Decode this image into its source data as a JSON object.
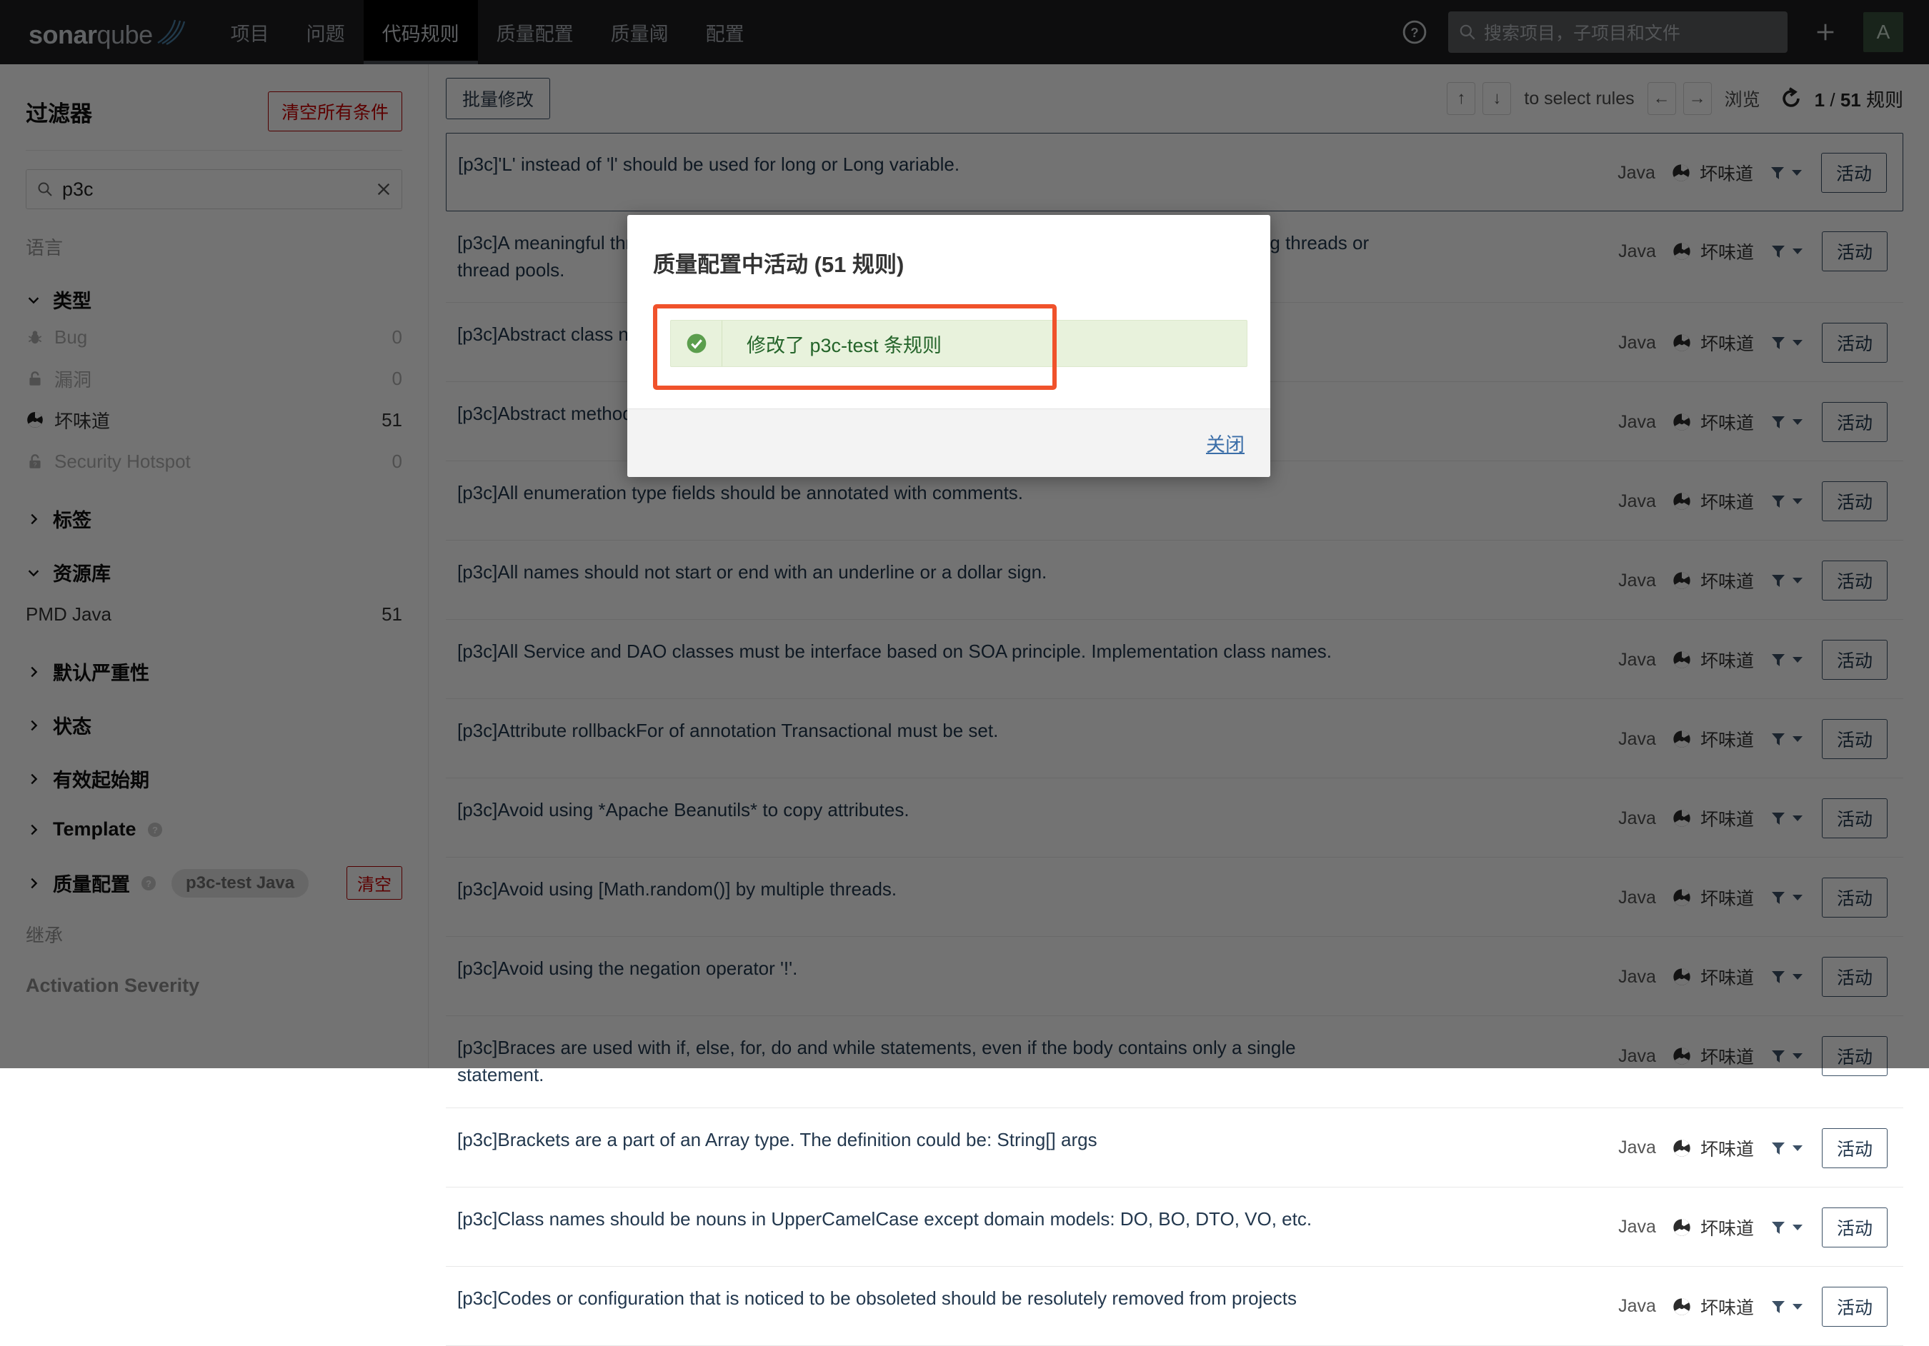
{
  "topnav": {
    "logo": {
      "bold": "sonar",
      "light": "qube",
      "icon": "sonarqube-logo-icon"
    },
    "items": [
      {
        "label": "项目",
        "active": false
      },
      {
        "label": "问题",
        "active": false
      },
      {
        "label": "代码规则",
        "active": true
      },
      {
        "label": "质量配置",
        "active": false
      },
      {
        "label": "质量阈",
        "active": false
      },
      {
        "label": "配置",
        "active": false
      }
    ],
    "help_icon": "help-circle-icon",
    "search": {
      "placeholder": "搜索项目，子项目和文件",
      "value": "",
      "icon": "search-icon"
    },
    "plus_icon": "plus-icon",
    "avatar_initial": "A",
    "avatar_color": "#39503d"
  },
  "sidebar": {
    "title": "过滤器",
    "clear_all_label": "清空所有条件",
    "search": {
      "value": "p3c",
      "placeholder": "",
      "icon": "search-icon",
      "clear_icon": "close-x-icon"
    },
    "language_label": "语言",
    "type_facet": {
      "label": "类型",
      "expanded": true,
      "rows": [
        {
          "icon": "bug-icon",
          "label": "Bug",
          "count": "0",
          "dim": true
        },
        {
          "icon": "vulnerability-icon",
          "label": "漏洞",
          "count": "0",
          "dim": true
        },
        {
          "icon": "code-smell-icon",
          "label": "坏味道",
          "count": "51",
          "dim": false
        },
        {
          "icon": "security-hotspot-icon",
          "label": "Security Hotspot",
          "count": "0",
          "dim": true
        }
      ]
    },
    "tags_facet": {
      "label": "标签",
      "expanded": false
    },
    "repo_facet": {
      "label": "资源库",
      "expanded": true,
      "rows": [
        {
          "label": "PMD Java",
          "count": "51"
        }
      ]
    },
    "severity_facet": {
      "label": "默认严重性",
      "expanded": false
    },
    "status_facet": {
      "label": "状态",
      "expanded": false
    },
    "available_since_facet": {
      "label": "有效起始期",
      "expanded": false
    },
    "template_facet": {
      "label": "Template",
      "expanded": false,
      "help_icon": "help-circle-icon"
    },
    "quality_profile_facet": {
      "label": "质量配置",
      "expanded": false,
      "help_icon": "help-circle-icon",
      "chip": "p3c-test Java",
      "clear_label": "清空"
    },
    "inheritance_label": "继承",
    "activation_severity_label": "Activation Severity"
  },
  "main": {
    "bulk_change_label": "批量修改",
    "toolbar": {
      "key_up": "↑",
      "key_down": "↓",
      "select_rules_text": "to select rules",
      "key_left": "←",
      "key_right": "→",
      "navigate_text": "浏览",
      "reload_icon": "reload-icon",
      "count_current": "1",
      "count_separator": "/",
      "count_total": "51",
      "count_suffix": "规则"
    },
    "row_meta": {
      "language": "Java",
      "type_icon": "code-smell-icon",
      "type_label": "坏味道",
      "filter_icon": "funnel-icon",
      "caret_icon": "chevron-down-icon",
      "activate_label": "活动"
    },
    "rules": [
      {
        "title": "[p3c]'L' instead of 'l' should be used for long or Long variable.",
        "selected": true
      },
      {
        "title": "[p3c]A meaningful thread name is helpful to trace the error information, so set a name when creating threads or thread pools.",
        "selected": false
      },
      {
        "title": "[p3c]Abstract class names must start with Abstract or Base.",
        "selected": false
      },
      {
        "title": "[p3c]Abstract methods in an abstract class must not be declared private.",
        "selected": false
      },
      {
        "title": "[p3c]All enumeration type fields should be annotated with comments.",
        "selected": false
      },
      {
        "title": "[p3c]All names should not start or end with an underline or a dollar sign.",
        "selected": false
      },
      {
        "title": "[p3c]All Service and DAO classes must be interface based on SOA principle. Implementation class names.",
        "selected": false
      },
      {
        "title": "[p3c]Attribute rollbackFor of annotation Transactional must be set.",
        "selected": false
      },
      {
        "title": "[p3c]Avoid using *Apache Beanutils* to copy attributes.",
        "selected": false
      },
      {
        "title": "[p3c]Avoid using [Math.random()] by multiple threads.",
        "selected": false
      },
      {
        "title": "[p3c]Avoid using the negation operator '!'.",
        "selected": false
      },
      {
        "title": "[p3c]Braces are used with if, else, for, do and while statements, even if the body contains only a single statement.",
        "selected": false
      },
      {
        "title": "[p3c]Brackets are a part of an Array type. The definition could be: String[] args",
        "selected": false
      },
      {
        "title": "[p3c]Class names should be nouns in UpperCamelCase except domain models: DO, BO, DTO, VO, etc.",
        "selected": false
      },
      {
        "title": "[p3c]Codes or configuration that is noticed to be obsoleted should be resolutely removed from projects",
        "selected": false
      }
    ]
  },
  "modal": {
    "title": "质量配置中活动 (51 规则)",
    "alert": {
      "icon": "check-circle-icon",
      "text": "修改了 p3c-test 条规则",
      "type": "success"
    },
    "highlight_color": "#f0522b",
    "close_label": "关闭"
  }
}
